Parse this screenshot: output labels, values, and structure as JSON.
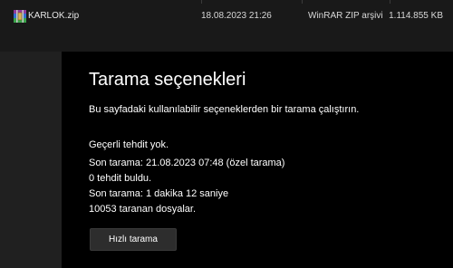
{
  "file_row": {
    "icon": "winrar-archive-icon",
    "name": "KARLOK.zip",
    "date": "18.08.2023 21:26",
    "type": "WinRAR ZIP arşivi",
    "size": "1.114.855 KB"
  },
  "panel": {
    "title": "Tarama seçenekleri",
    "subtitle": "Bu sayfadaki kullanılabilir seçeneklerden bir tarama çalıştırın.",
    "status_lines": [
      "Geçerli tehdit yok.",
      "Son tarama: 21.08.2023 07:48 (özel tarama)",
      "0 tehdit buldu.",
      "Son tarama: 1 dakika 12 saniye",
      "10053 taranan dosyalar."
    ],
    "quick_scan_label": "Hızlı tarama"
  },
  "colors": {
    "panel_bg": "#000000",
    "window_bg": "#191919",
    "button_bg": "#2d2d2d"
  }
}
